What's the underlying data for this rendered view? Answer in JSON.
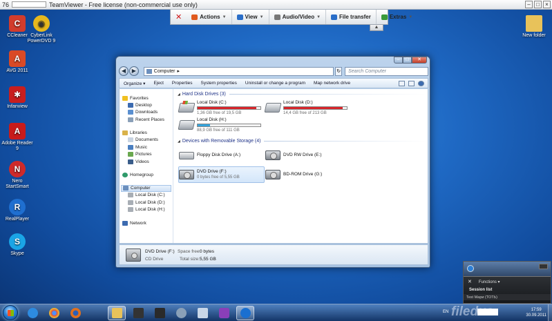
{
  "teamviewer": {
    "title_id": "76",
    "title": "TeamViewer - Free license (non-commercial use only)",
    "toolbar": [
      {
        "label": "Actions",
        "icon": "actions-icon",
        "color": "#e05a1e"
      },
      {
        "label": "View",
        "icon": "view-icon",
        "color": "#2a6ec8"
      },
      {
        "label": "Audio/Video",
        "icon": "audio-video-icon",
        "color": "#777777"
      },
      {
        "label": "File transfer",
        "icon": "file-transfer-icon",
        "color": "#2a6ec8"
      },
      {
        "label": "Extras",
        "icon": "extras-icon",
        "color": "#3a9a3a"
      }
    ],
    "panel": {
      "function_label": "Functions",
      "session_label": "Session list",
      "user_text": "Test Мари (ТОТЬ)"
    }
  },
  "desktop_icons": [
    {
      "label": "CCleaner",
      "color": "#d23c2c",
      "glyph": "C"
    },
    {
      "label": "AVG 2011",
      "color": "#d94a26",
      "glyph": "A"
    },
    {
      "label": "Infanview",
      "color": "#c81e1e",
      "glyph": "✱"
    },
    {
      "label": "Adobe Reader 9",
      "color": "#c81b1b",
      "glyph": "A"
    },
    {
      "label": "Nero StartSmart",
      "color": "#cf2a2a",
      "glyph": "N"
    },
    {
      "label": "RealPlayer",
      "color": "#1f6fd0",
      "glyph": "R"
    },
    {
      "label": "Skype",
      "color": "#1aa5e6",
      "glyph": "S"
    },
    {
      "label": "CyberLink PowerDVD 9",
      "color": "#e6b81e",
      "glyph": "◉"
    },
    {
      "label": "New folder",
      "color": "#e8c25a",
      "glyph": ""
    }
  ],
  "explorer": {
    "address": "Computer",
    "search_placeholder": "Search Computer",
    "commands": [
      "Organize",
      "Eject",
      "Properties",
      "System properties",
      "Uninstall or change a program",
      "Map network drive"
    ],
    "nav": {
      "favorites": "Favorites",
      "favorites_items": [
        "Desktop",
        "Downloads",
        "Recent Places"
      ],
      "libraries": "Libraries",
      "libraries_items": [
        "Documents",
        "Music",
        "Pictures",
        "Videos"
      ],
      "homegroup": "Homegroup",
      "computer": "Computer",
      "computer_items": [
        "Local Disk (C:)",
        "Local Disk (D:)",
        "Local Disk (H:)"
      ],
      "network": "Network"
    },
    "hard_disk_header": "Hard Disk Drives (3)",
    "removable_header": "Devices with Removable Storage (4)",
    "hard_disks": [
      {
        "name": "Local Disk (C:)",
        "free": "1,36 GB free of 19,5 GB",
        "used_fraction": 0.93,
        "bar_color": "#d8262b"
      },
      {
        "name": "Local Disk (D:)",
        "free": "14,4 GB free of 213 GB",
        "used_fraction": 0.93,
        "bar_color": "#d8262b"
      },
      {
        "name": "Local Disk (H:)",
        "free": "88,9 GB free of 111 GB",
        "used_fraction": 0.2,
        "bar_color": "#33a3dc"
      }
    ],
    "removable": [
      {
        "name": "Floppy Disk Drive (A:)",
        "free": "",
        "kind": "floppy"
      },
      {
        "name": "DVD RW Drive (E:)",
        "free": "",
        "kind": "optical"
      },
      {
        "name": "DVD Drive (F:)",
        "free": "0 bytes free of 5,55 GB",
        "kind": "optical"
      },
      {
        "name": "BD-ROM Drive (G:)",
        "free": "",
        "kind": "optical"
      }
    ],
    "details": {
      "name": "DVD Drive (F:)",
      "type": "CD Drive",
      "space_free_label": "Space free:",
      "space_free_value": "0 bytes",
      "total_size_label": "Total size:",
      "total_size_value": "5,55 GB"
    }
  },
  "taskbar": {
    "language": "EN",
    "time": "17:59",
    "date": "30.09.2011",
    "watermark": "filedus",
    "apps": [
      {
        "name": "internet-explorer",
        "color": "#2d8be0"
      },
      {
        "name": "chrome",
        "color": "#dd4b3a"
      },
      {
        "name": "firefox",
        "color": "#e0701e"
      },
      {
        "name": "explorer-folder",
        "color": "#e8c25a"
      },
      {
        "name": "book",
        "color": "#333333"
      },
      {
        "name": "book-2",
        "color": "#2a2a2a"
      },
      {
        "name": "avg",
        "color": "#8aa0b8"
      },
      {
        "name": "notepad",
        "color": "#c9d7e8"
      },
      {
        "name": "purple-app",
        "color": "#8a3fb8"
      },
      {
        "name": "teamviewer",
        "color": "#1a6fd0"
      }
    ]
  }
}
